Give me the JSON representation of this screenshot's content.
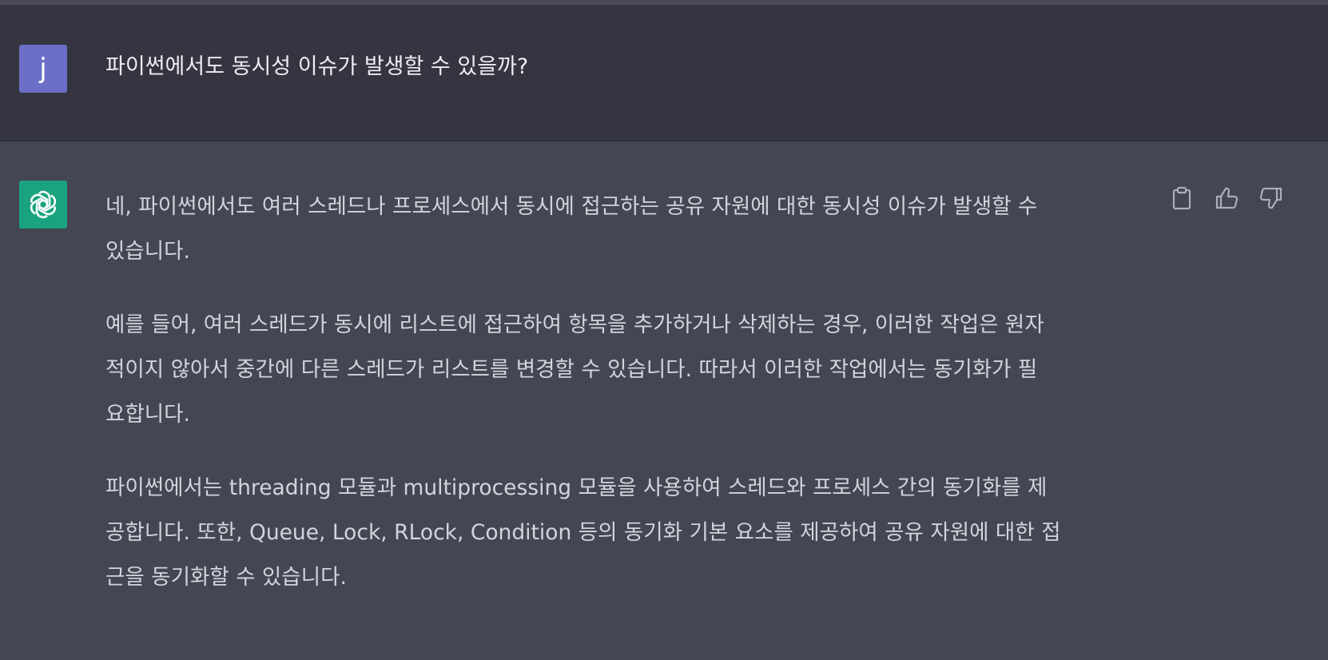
{
  "user_message": {
    "avatar_letter": "j",
    "text": "파이썬에서도 동시성 이슈가 발생할 수 있을까?"
  },
  "assistant_message": {
    "avatar_icon": "openai-logo-icon",
    "paragraphs": [
      [
        "네, 파이썬에서도 여러 스레드나 프로세스에서 동시에 접근하는 공유 자원에 대한 동시성 이슈가 발생할 수",
        "있습니다."
      ],
      [
        "예를 들어, 여러 스레드가 동시에 리스트에 접근하여 항목을 추가하거나 삭제하는 경우, 이러한 작업은 원자",
        "적이지 않아서 중간에 다른 스레드가 리스트를 변경할 수 있습니다. 따라서 이러한 작업에서는 동기화가 필",
        "요합니다."
      ],
      [
        "파이썬에서는 threading 모듈과 multiprocessing 모듈을 사용하여 스레드와 프로세스 간의 동기화를 제",
        "공합니다. 또한, Queue, Lock, RLock, Condition 등의 동기화 기본 요소를 제공하여 공유 자원에 대한 접",
        "근을 동기화할 수 있습니다."
      ]
    ],
    "actions": {
      "copy": "clipboard-icon",
      "like": "thumbs-up-icon",
      "dislike": "thumbs-down-icon"
    }
  },
  "colors": {
    "user_bg": "#343541",
    "assistant_bg": "#444654",
    "user_avatar": "#6b6fc7",
    "bot_avatar": "#19a37f",
    "text": "#d1d5db"
  }
}
